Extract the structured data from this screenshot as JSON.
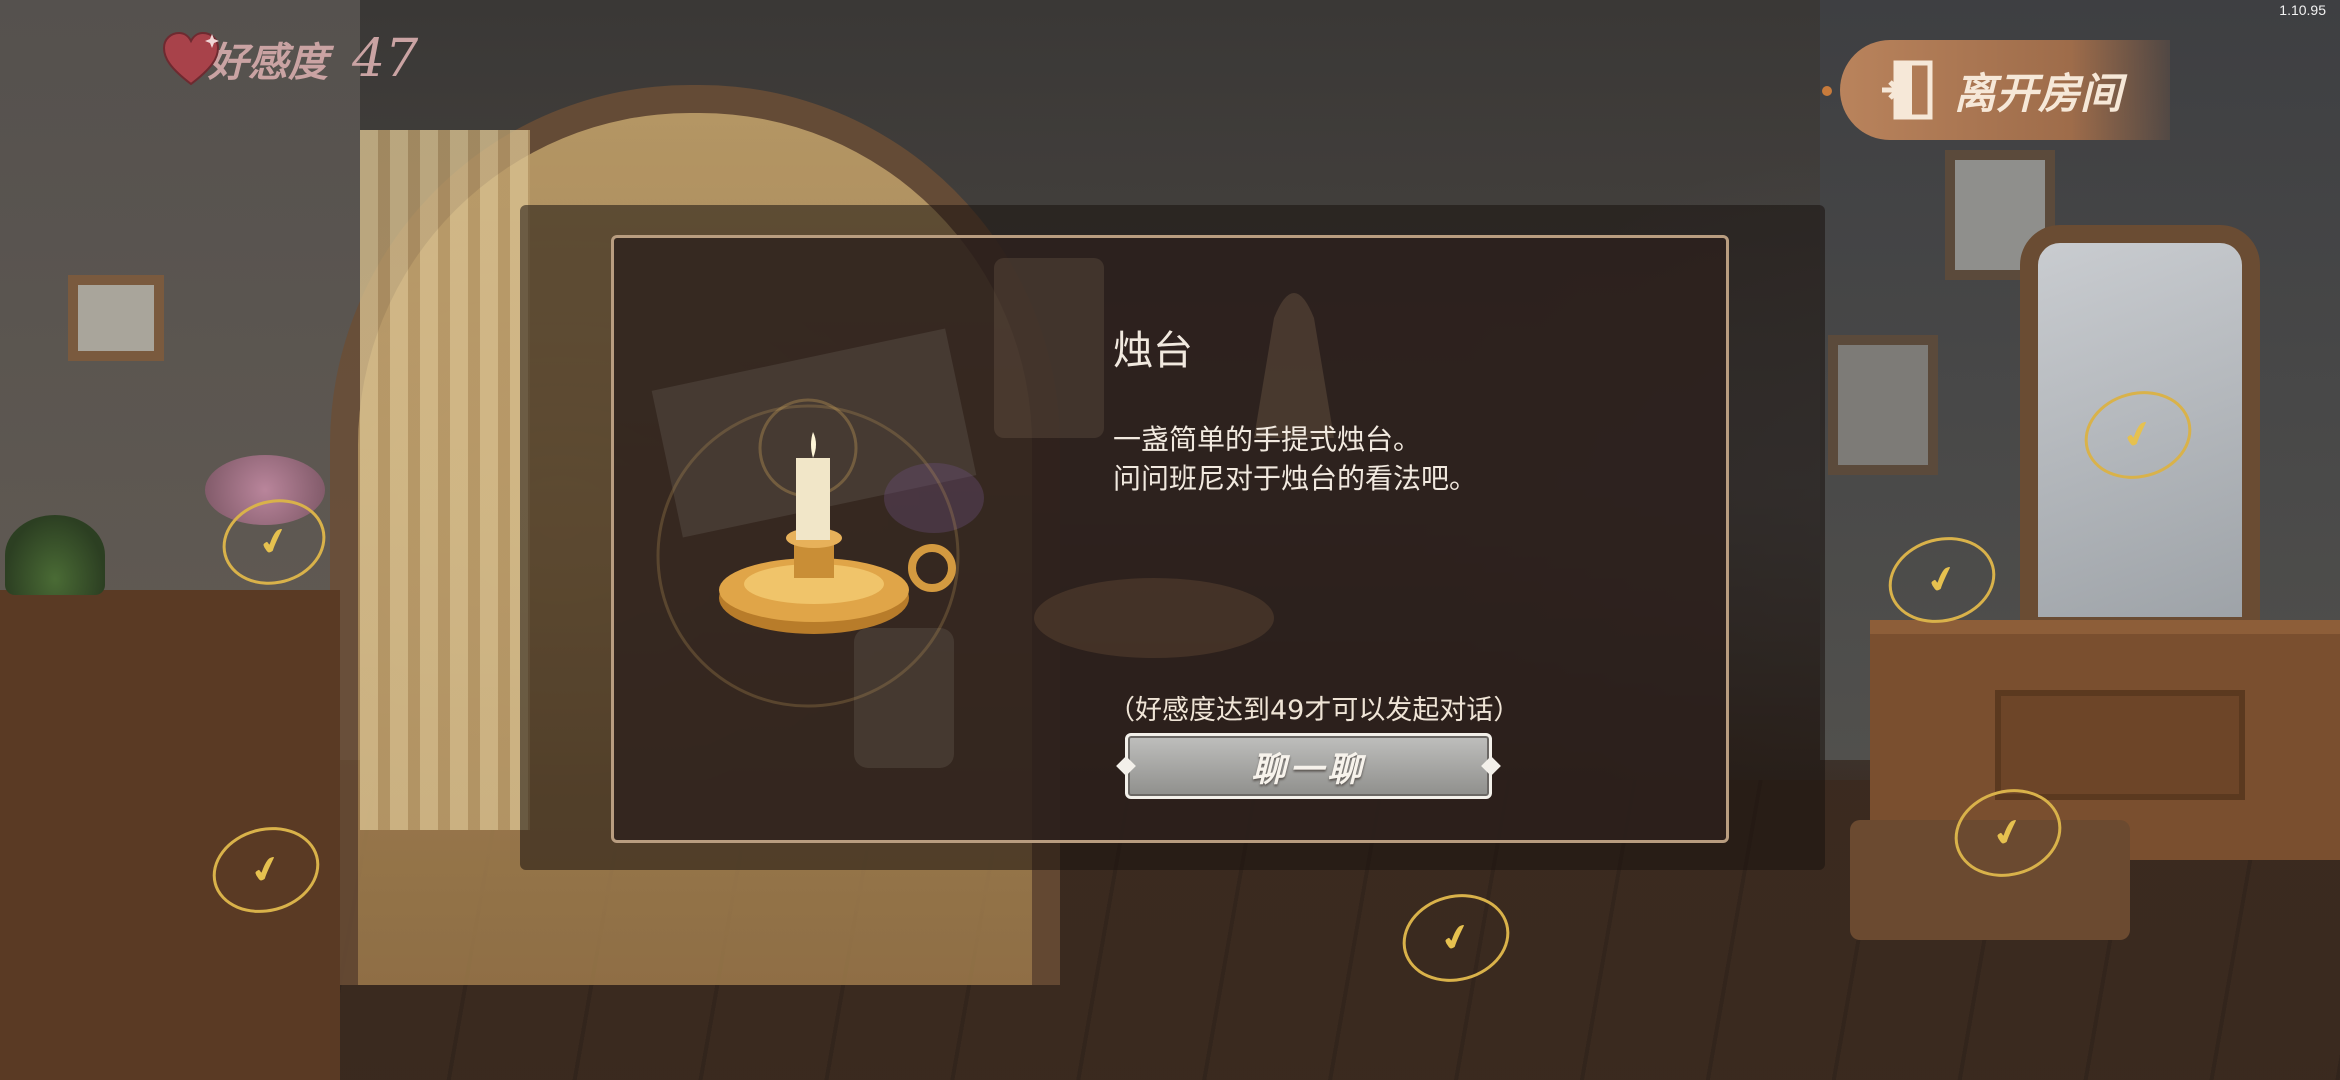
{
  "version": "1.10.95",
  "hud": {
    "affinity_label": "好感度",
    "affinity_value": "47",
    "heart_icon": "heart-icon",
    "leave_label": "离开房间",
    "leave_icon": "door-exit-icon"
  },
  "item": {
    "title": "烛台",
    "description_lines": [
      "一盏简单的手提式烛台。",
      "问问班尼对于烛台的看法吧。"
    ],
    "requirement": "（好感度达到49才可以发起对话）",
    "chat_label": "聊一聊",
    "image_icon": "candlestick-icon"
  },
  "colors": {
    "accent_gold": "#d9b24a",
    "leave_button": "#b9835c",
    "modal_border": "#b99d80",
    "affinity_text": "#caa3a3"
  },
  "check_icon": "checkmark-icon"
}
